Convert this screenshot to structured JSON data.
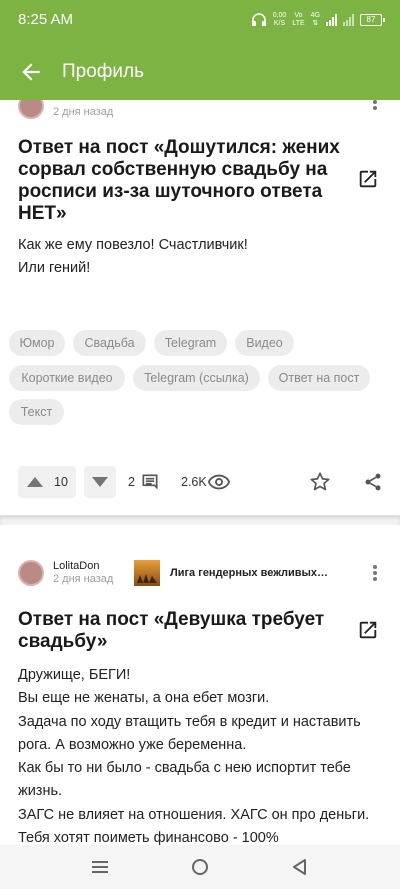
{
  "status_bar": {
    "time": "8:25 AM",
    "speed_value": "0,00",
    "speed_unit": "K/S",
    "net_top": "Vo",
    "net_bottom": "LTE",
    "net_gen": "4G",
    "battery": "87"
  },
  "app_bar": {
    "title": "Профиль",
    "back_icon": "arrow-back-icon",
    "color": "#7cb342"
  },
  "post1": {
    "ago": "2 дня назад",
    "title": "Ответ на пост «Дошутился: жених сорвал собственную свадьбу на росписи из-за шуточного ответа НЕТ»",
    "title_lines": [
      "Ответ на пост «Дошутился: жених",
      "сорвал собственную свадьбу на",
      "росписи из-за шуточного ответа",
      "НЕТ»"
    ],
    "body_lines": [
      "Как же ему повезло! Счастливчик!",
      "Или гений!"
    ],
    "tags": [
      "Юмор",
      "Свадьба",
      "Telegram",
      "Видео",
      "Короткие видео",
      "Telegram (ссылка)",
      "Ответ на пост",
      "Текст"
    ],
    "rating": "10",
    "comments": "2",
    "views": "2.6K"
  },
  "post2": {
    "author": "LolitaDon",
    "ago": "2 дня назад",
    "community": "Лига гендерных вежливых…",
    "title_lines": [
      "Ответ на пост «Девушка требует",
      "свадьбу»"
    ],
    "body_lines": [
      "Дружище, БЕГИ!",
      "Вы еще не женаты, а она ебет мозги.",
      "Задача по ходу втащить тебя в кредит и наставить",
      "рога. А возможно уже беременна.",
      "Как бы то ни было - свадьба с нею испортит тебе",
      "жизнь.",
      "ЗАГС не влияет на отношения. ХАГС он про деньги.",
      "Тебя хотят поиметь финансово - 100%"
    ]
  }
}
